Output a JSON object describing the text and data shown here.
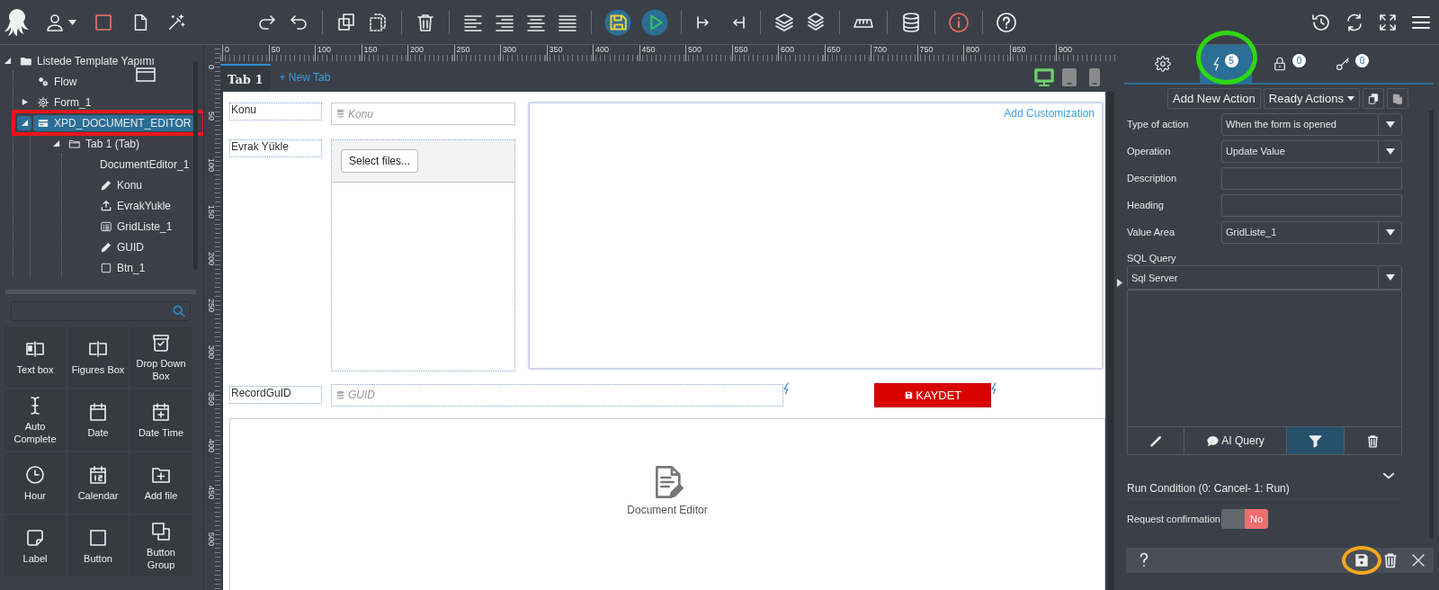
{
  "tree": [
    {
      "kind": "folder",
      "label": "Listede Template Yapımı",
      "expanded": true,
      "selected": false,
      "annotated": false,
      "children": [
        {
          "kind": "flow",
          "label": "Flow",
          "selected": false,
          "annotated": false
        },
        {
          "kind": "form",
          "label": "Form_1",
          "expanded": false,
          "selected": false,
          "annotated": false
        },
        {
          "kind": "card",
          "label": "XPD_DOCUMENT_EDITOR",
          "expanded": true,
          "selected": true,
          "annotated": true,
          "children": [
            {
              "kind": "tab",
              "label": "Tab 1 (Tab)",
              "expanded": true,
              "selected": false,
              "annotated": false,
              "children": [
                {
                  "kind": "plain",
                  "label": "DocumentEditor_1",
                  "selected": false,
                  "annotated": false
                },
                {
                  "kind": "pencil",
                  "label": "Konu",
                  "selected": false,
                  "annotated": false
                },
                {
                  "kind": "upload",
                  "label": "EvrakYukle",
                  "selected": false,
                  "annotated": false
                },
                {
                  "kind": "list",
                  "label": "GridListe_1",
                  "selected": false,
                  "annotated": false
                },
                {
                  "kind": "pencil",
                  "label": "GUID",
                  "selected": false,
                  "annotated": false
                },
                {
                  "kind": "square",
                  "label": "Btn_1",
                  "selected": false,
                  "annotated": false
                }
              ]
            }
          ]
        }
      ]
    }
  ],
  "palette": [
    {
      "kind": "textbox",
      "label": "Text box"
    },
    {
      "kind": "figures",
      "label": "Figures Box"
    },
    {
      "kind": "dropdown",
      "label": "Drop Down Box"
    },
    {
      "kind": "autocomplete",
      "label": "Auto Complete"
    },
    {
      "kind": "date",
      "label": "Date"
    },
    {
      "kind": "datetime",
      "label": "Date Time"
    },
    {
      "kind": "hour",
      "label": "Hour"
    },
    {
      "kind": "calendar",
      "label": "Calendar"
    },
    {
      "kind": "addfile",
      "label": "Add file"
    },
    {
      "kind": "label",
      "label": "Label"
    },
    {
      "kind": "button",
      "label": "Button"
    },
    {
      "kind": "buttongroup",
      "label": "Button Group"
    }
  ],
  "ruler": {
    "horizontal": [
      "0",
      "50",
      "100",
      "150",
      "200",
      "250",
      "300",
      "350",
      "400",
      "450",
      "500",
      "550",
      "600",
      "650",
      "700",
      "750",
      "800",
      "850",
      "900"
    ],
    "vertical": [
      "0",
      "50",
      "100",
      "150",
      "200",
      "250",
      "300",
      "350",
      "400",
      "450",
      "500"
    ]
  },
  "designer_tabs": [
    {
      "label": "Tab 1",
      "selected": true
    }
  ],
  "new_tab_link": "+ New Tab",
  "devices": [
    {
      "kind": "desktop",
      "selected": true
    },
    {
      "kind": "tablet",
      "selected": false
    },
    {
      "kind": "phone",
      "selected": false
    }
  ],
  "form": {
    "konu": {
      "label": "Konu",
      "placeholder": "Konu"
    },
    "upload": {
      "label": "Evrak Yükle",
      "button": "Select files..."
    },
    "customization_link": "Add Customization",
    "guid": {
      "label": "RecordGuID",
      "placeholder": "GUID"
    },
    "save_button": "KAYDET",
    "document_editor": "Document Editor"
  },
  "properties": {
    "tabs": [
      {
        "kind": "settings",
        "selected": false,
        "annotated": false
      },
      {
        "kind": "events",
        "count": "5",
        "selected": true,
        "annotated": true
      },
      {
        "kind": "permissions",
        "count": "0",
        "selected": false,
        "annotated": false
      },
      {
        "kind": "links",
        "count": "0",
        "selected": false,
        "annotated": false
      }
    ],
    "add_action": "Add New Action",
    "ready_actions": "Ready Actions",
    "fields": [
      {
        "kind": "select",
        "label": "Type of action",
        "value": "When the form is opened"
      },
      {
        "kind": "select",
        "label": "Operation",
        "value": "Update Value"
      },
      {
        "kind": "input",
        "label": "Description"
      },
      {
        "kind": "input",
        "label": "Heading"
      },
      {
        "kind": "select",
        "label": "Value Area",
        "value": "GridListe_1"
      }
    ],
    "sql_query": {
      "label": "SQL Query",
      "dialect": "Sql Server",
      "tools": [
        {
          "kind": "edit",
          "selected": false
        },
        {
          "kind": "ai",
          "label": "AI Query",
          "selected": false
        },
        {
          "kind": "filter",
          "selected": true
        },
        {
          "kind": "delete",
          "selected": false
        }
      ]
    },
    "run_condition": {
      "label": "Run Condition (0: Cancel- 1: Run)",
      "expanded": false
    },
    "request_confirmation": {
      "label": "Request confirmation",
      "on": false,
      "value_label": "No"
    },
    "footer_buttons": [
      {
        "kind": "help",
        "annotated": false
      },
      {
        "kind": "save",
        "annotated": true
      },
      {
        "kind": "delete",
        "annotated": false
      },
      {
        "kind": "close",
        "annotated": false
      }
    ]
  }
}
